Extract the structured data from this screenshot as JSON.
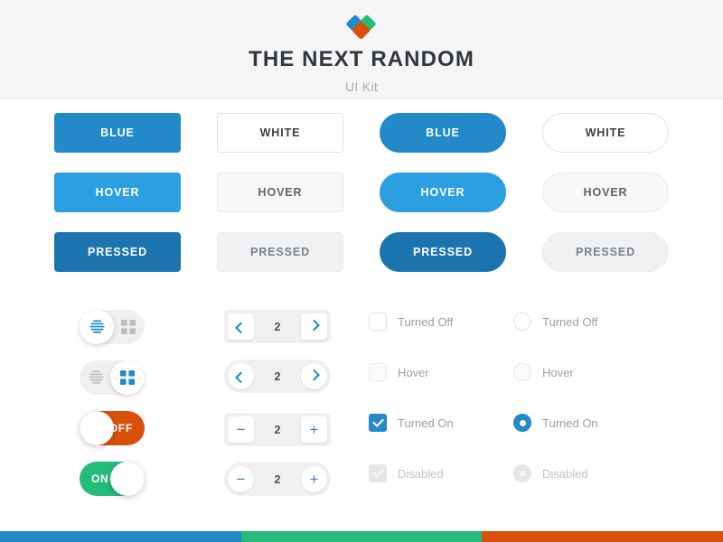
{
  "header": {
    "logo_icon": "heart-diamonds-logo",
    "logo_colors": {
      "left": "#2389c9",
      "right": "#23bd79",
      "bottom": "#d9500a"
    },
    "brand": "THE NEXT RANDOM",
    "subtitle": "UI Kit",
    "background": "#f5f5f5"
  },
  "palette": {
    "blue": "#2389c9",
    "blue_hover": "#2c9fe0",
    "blue_pressed": "#1b74ad",
    "green": "#23bd79",
    "orange": "#d9500a",
    "white": "#ffffff",
    "white_hover": "#f8f8f8",
    "white_pressed": "#f0f1f2",
    "text_dark": "#31373f",
    "text_muted": "#9aa0a6"
  },
  "buttons": {
    "rows": [
      {
        "state": "normal",
        "square_blue": "BLUE",
        "square_white": "WHITE",
        "round_blue": "BLUE",
        "round_white": "WHITE"
      },
      {
        "state": "hover",
        "square_blue": "HOVER",
        "square_white": "HOVER",
        "round_blue": "HOVER",
        "round_white": "HOVER"
      },
      {
        "state": "pressed",
        "square_blue": "PRESSED",
        "square_white": "PRESSED",
        "round_blue": "PRESSED",
        "round_white": "PRESSED"
      }
    ]
  },
  "segmented": [
    {
      "name": "view-toggle-list-active",
      "active": "list",
      "list_icon": "list-lines-icon",
      "grid_icon": "grid-squares-icon"
    },
    {
      "name": "view-toggle-grid-active",
      "active": "grid",
      "list_icon": "list-lines-icon",
      "grid_icon": "grid-squares-icon"
    }
  ],
  "switches": [
    {
      "name": "switch-off",
      "label": "OFF",
      "state": "off",
      "color": "#d9500a"
    },
    {
      "name": "switch-on",
      "label": "ON",
      "state": "on",
      "color": "#23bd79"
    }
  ],
  "steppers": [
    {
      "name": "stepper-chevron-square",
      "shape": "square",
      "prev_icon": "chevron-left-icon",
      "next_icon": "chevron-right-icon",
      "value": "2"
    },
    {
      "name": "stepper-chevron-round",
      "shape": "round",
      "prev_icon": "chevron-left-icon",
      "next_icon": "chevron-right-icon",
      "value": "2"
    },
    {
      "name": "stepper-plusminus-square",
      "shape": "square",
      "prev_icon": "minus-icon",
      "next_icon": "plus-icon",
      "minus": "−",
      "plus": "+",
      "value": "2"
    },
    {
      "name": "stepper-plusminus-round",
      "shape": "round",
      "prev_icon": "minus-icon",
      "next_icon": "plus-icon",
      "minus": "−",
      "plus": "+",
      "value": "2"
    }
  ],
  "checkboxes": [
    {
      "label": "Turned Off",
      "state": "off"
    },
    {
      "label": "Hover",
      "state": "hover"
    },
    {
      "label": "Turned On",
      "state": "on"
    },
    {
      "label": "Disabled",
      "state": "disabled"
    }
  ],
  "radios": [
    {
      "label": "Turned Off",
      "state": "off"
    },
    {
      "label": "Hover",
      "state": "hover"
    },
    {
      "label": "Turned On",
      "state": "on"
    },
    {
      "label": "Disabled",
      "state": "disabled"
    }
  ],
  "footer_stripe": {
    "segments": [
      {
        "name": "stripe-blue",
        "color": "#2389c9"
      },
      {
        "name": "stripe-green",
        "color": "#23bd79"
      },
      {
        "name": "stripe-orange",
        "color": "#d9500a"
      }
    ]
  }
}
